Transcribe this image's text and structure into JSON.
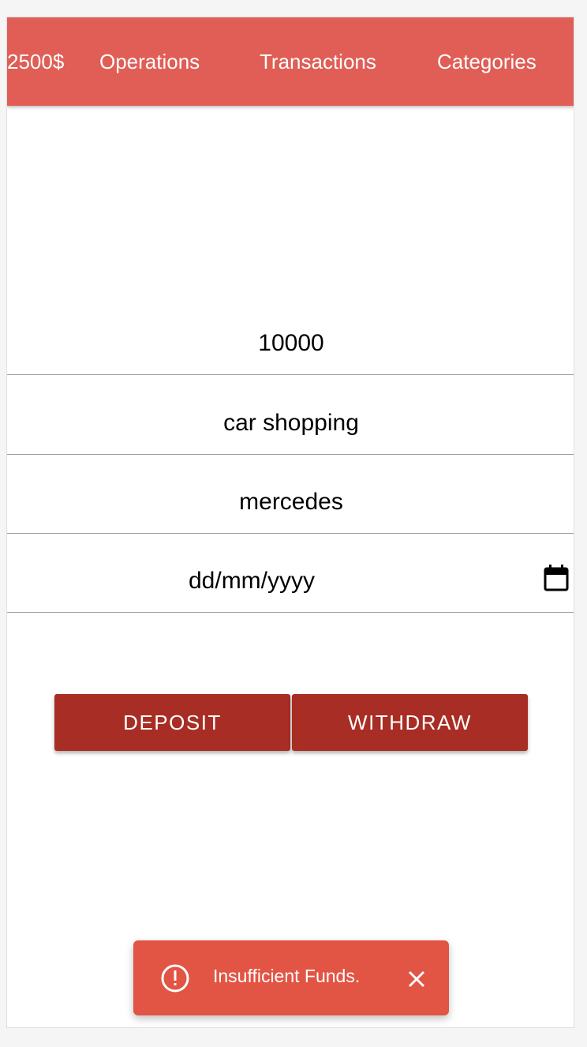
{
  "header": {
    "balance": "2500$",
    "nav": {
      "operations": "Operations",
      "transactions": "Transactions",
      "categories": "Categories"
    },
    "color": "#e05e55"
  },
  "form": {
    "amount_value": "10000",
    "description_value": "car shopping",
    "category_value": "mercedes",
    "date_placeholder": "dd/mm/yyyy"
  },
  "actions": {
    "deposit_label": "DEPOSIT",
    "withdraw_label": "WITHDRAW",
    "button_color": "#a82d24"
  },
  "snackbar": {
    "message": "Insufficient Funds.",
    "icon": "alert-circle-icon",
    "close_icon": "close-icon",
    "color": "#e25443"
  }
}
